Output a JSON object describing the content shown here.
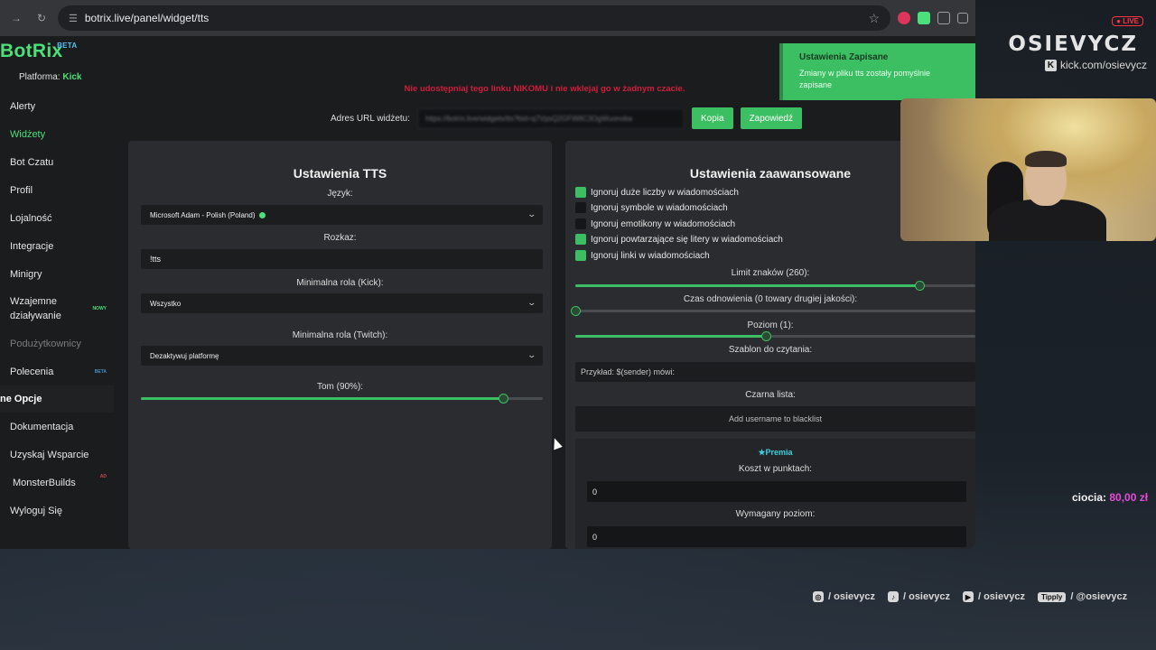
{
  "browser": {
    "url": "botrix.live/panel/widget/tts"
  },
  "app": {
    "logo": "BotRix",
    "logo_badge": "BETA",
    "platform_label": "Platforma:",
    "platform_value": "Kick"
  },
  "sidebar": {
    "items": [
      {
        "label": "Alerty"
      },
      {
        "label": "Widżety"
      },
      {
        "label": "Bot Czatu"
      },
      {
        "label": "Profil"
      },
      {
        "label": "Lojalność"
      },
      {
        "label": "Integracje"
      },
      {
        "label": "Minigry"
      },
      {
        "label": "Wzajemne\ndziaływanie",
        "badge": "NOWY"
      },
      {
        "label": "Podużytkownicy"
      },
      {
        "label": "Polecenia",
        "badge": "BETA"
      }
    ],
    "section": "ne Opcje",
    "bottom_items": [
      {
        "label": "Dokumentacja"
      },
      {
        "label": "Uzyskaj Wsparcie"
      },
      {
        "label": "MonsterBuilds",
        "badge": "AD"
      },
      {
        "label": "Wyloguj Się"
      }
    ]
  },
  "main": {
    "warning": "Nie udostępniaj tego linku NIKOMU i nie wklejaj go w żadnym czacie.",
    "url_label": "Adres URL widżetu:",
    "url_value": "https://botrix.live/widgets/tts?bid=q7VpsQ2GFW8C3OgWuonoba",
    "copy_button": "Kopia",
    "preview_button": "Zapowiedź"
  },
  "tts": {
    "title": "Ustawienia TTS",
    "language_label": "Język:",
    "language_value": "Microsoft Adam - Polish (Poland)",
    "command_label": "Rozkaz:",
    "command_value": "!tts",
    "role_kick_label": "Minimalna rola (Kick):",
    "role_kick_value": "Wszystko",
    "role_twitch_label": "Minimalna rola (Twitch):",
    "role_twitch_value": "Dezaktywuj platformę",
    "volume_label": "Tom (90%):",
    "volume_value": 0.9
  },
  "advanced": {
    "title": "Ustawienia zaawansowane",
    "checkboxes": [
      {
        "label": "Ignoruj duże liczby w wiadomościach",
        "checked": true
      },
      {
        "label": "Ignoruj symbole w wiadomościach",
        "checked": false
      },
      {
        "label": "Ignoruj emotikony w wiadomościach",
        "checked": false
      },
      {
        "label": "Ignoruj powtarzające się litery w wiadomościach",
        "checked": true
      },
      {
        "label": "Ignoruj linki w wiadomościach",
        "checked": true
      }
    ],
    "char_limit_label": "Limit znaków (260):",
    "char_limit_fraction": 0.86,
    "cooldown_label": "Czas odnowienia (0 towary drugiej jakości):",
    "cooldown_fraction": 0.0,
    "level_label": "Poziom (1):",
    "level_fraction": 0.476,
    "template_label": "Szablon do czytania:",
    "template_placeholder": "Przykład: $(sender) mówi:",
    "blacklist_label": "Czarna lista:",
    "blacklist_placeholder": "Add username to blacklist",
    "premium_title": "Premia",
    "cost_label": "Koszt w punktach:",
    "cost_value": "0",
    "req_level_label": "Wymagany poziom:",
    "req_level_value": "0"
  },
  "toast": {
    "title": "Ustawienia Zapisane",
    "message": "Zmiany w pliku tts zostały pomyślnie zapisane"
  },
  "overlay": {
    "live_badge": "● LIVE",
    "brand": "OSIEVYCZ",
    "kick_url": "kick.com/osievycz",
    "donation_name": "ciocia:",
    "donation_amount": "80,00 zł",
    "socials": [
      {
        "icon": "instagram-icon",
        "text": "/ osievycz"
      },
      {
        "icon": "tiktok-icon",
        "text": "/ osievycz"
      },
      {
        "icon": "youtube-icon",
        "text": "/ osievycz"
      },
      {
        "icon": "tipply-icon",
        "badge": "Tipply",
        "text": "/ @osievycz"
      }
    ]
  },
  "colors": {
    "accent": "#3cbf62",
    "warning": "#d11d3c",
    "premium": "#3cd0e0",
    "donation": "#e84ad8"
  }
}
